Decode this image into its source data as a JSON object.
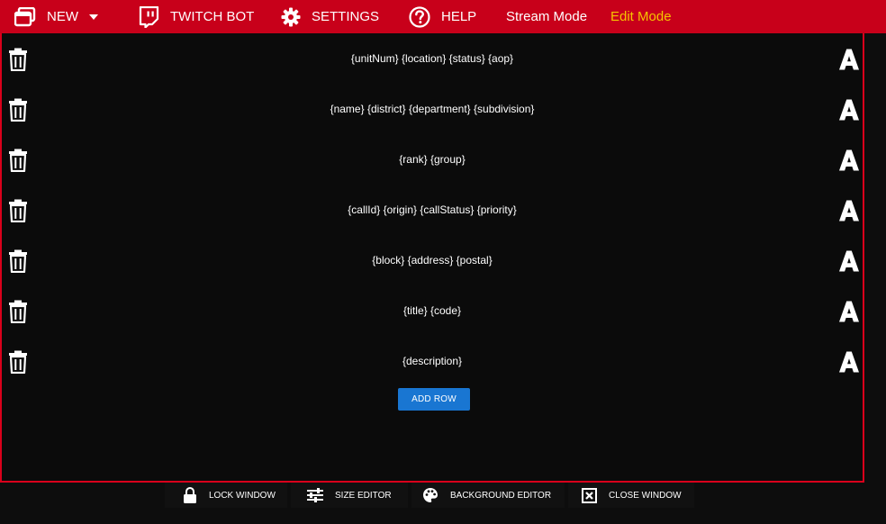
{
  "nav": {
    "new_label": "NEW",
    "twitch_label": "TWITCH BOT",
    "settings_label": "SETTINGS",
    "help_label": "HELP",
    "stream_mode_label": "Stream Mode",
    "edit_mode_label": "Edit Mode"
  },
  "colors": {
    "topbar": "#c8001a",
    "panel_border": "#d9001b",
    "edit_mode": "#f5c400",
    "add_row_button": "#1976d2"
  },
  "rows": [
    {
      "text": "{unitNum} {location} {status} {aop}"
    },
    {
      "text": "{name} {district} {department} {subdivision}"
    },
    {
      "text": "{rank} {group}"
    },
    {
      "text": "{callId} {origin} {callStatus} {priority}"
    },
    {
      "text": "{block} {address} {postal}"
    },
    {
      "text": "{title} {code}"
    },
    {
      "text": "{description}"
    }
  ],
  "add_row_label": "ADD ROW",
  "toolbar": {
    "lock_label": "LOCK WINDOW",
    "size_label": "SIZE EDITOR",
    "background_label": "BACKGROUND EDITOR",
    "close_label": "CLOSE WINDOW"
  },
  "icons": [
    "new-window-icon",
    "twitch-icon",
    "gear-icon",
    "help-icon",
    "trash-icon",
    "font-icon",
    "lock-icon",
    "sliders-icon",
    "palette-icon",
    "close-box-icon"
  ]
}
